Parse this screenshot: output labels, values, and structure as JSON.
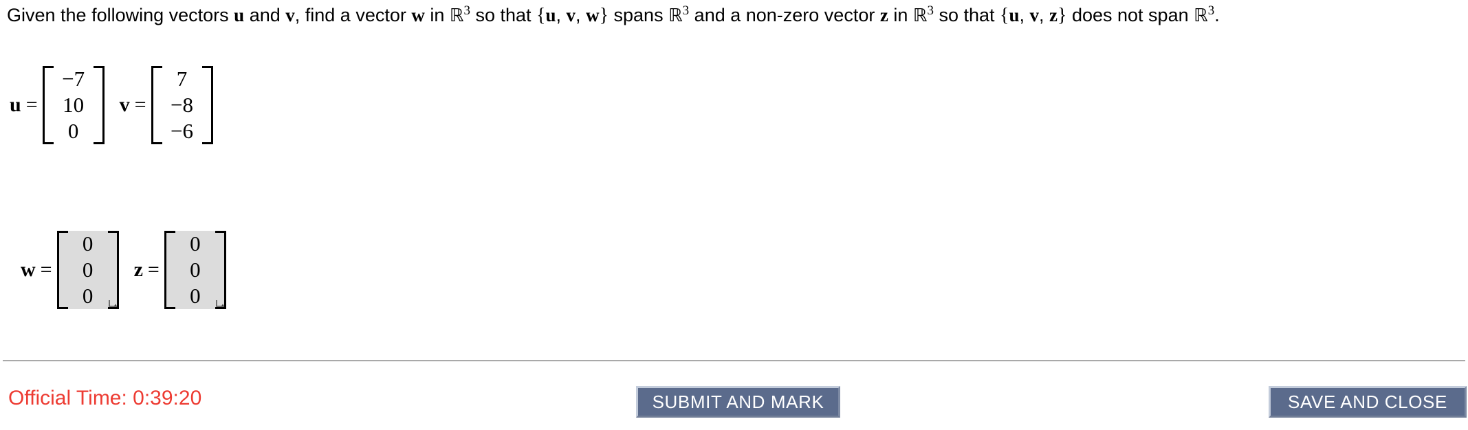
{
  "question": {
    "line1_a": "Given the following vectors ",
    "u_sym": "u",
    "line1_b": " and ",
    "v_sym": "v",
    "line1_c": ", find a vector ",
    "w_sym": "w",
    "line1_d": " in ",
    "field_sym": "ℝ",
    "field_exp": "3",
    "line1_e": " so that ",
    "set1_open": "{",
    "set1_u": "u",
    "set1_sep1": ", ",
    "set1_v": "v",
    "set1_sep2": ", ",
    "set1_w": "w",
    "set1_close": "}",
    "line1_f": " spans ",
    "line1_g": " and a non-zero vector ",
    "z_sym": "z",
    "line1_h": " in ",
    "line1_i": " so that ",
    "set2_open": "{",
    "set2_u": "u",
    "set2_sep1": ", ",
    "set2_v": "v",
    "set2_sep2": ", ",
    "set2_z": "z",
    "set2_close": "}",
    "line1_j": " does not span ",
    "line2_period": "."
  },
  "given_vectors": [
    {
      "name": "u",
      "equals": "=",
      "entries": [
        "−7",
        "10",
        "0"
      ]
    },
    {
      "name": "v",
      "equals": "=",
      "entries": [
        "7",
        "−8",
        "−6"
      ]
    }
  ],
  "answer_vectors": [
    {
      "name": "w",
      "equals": "=",
      "entries": [
        "0",
        "0",
        "0"
      ]
    },
    {
      "name": "z",
      "equals": "=",
      "entries": [
        "0",
        "0",
        "0"
      ]
    }
  ],
  "footer": {
    "official_time_label": "Official Time: 0:39:20",
    "submit_button": "SUBMIT AND MARK",
    "save_button": "SAVE AND CLOSE",
    "time_color": "#ed3b32",
    "button_color": "#5b6b8c"
  }
}
